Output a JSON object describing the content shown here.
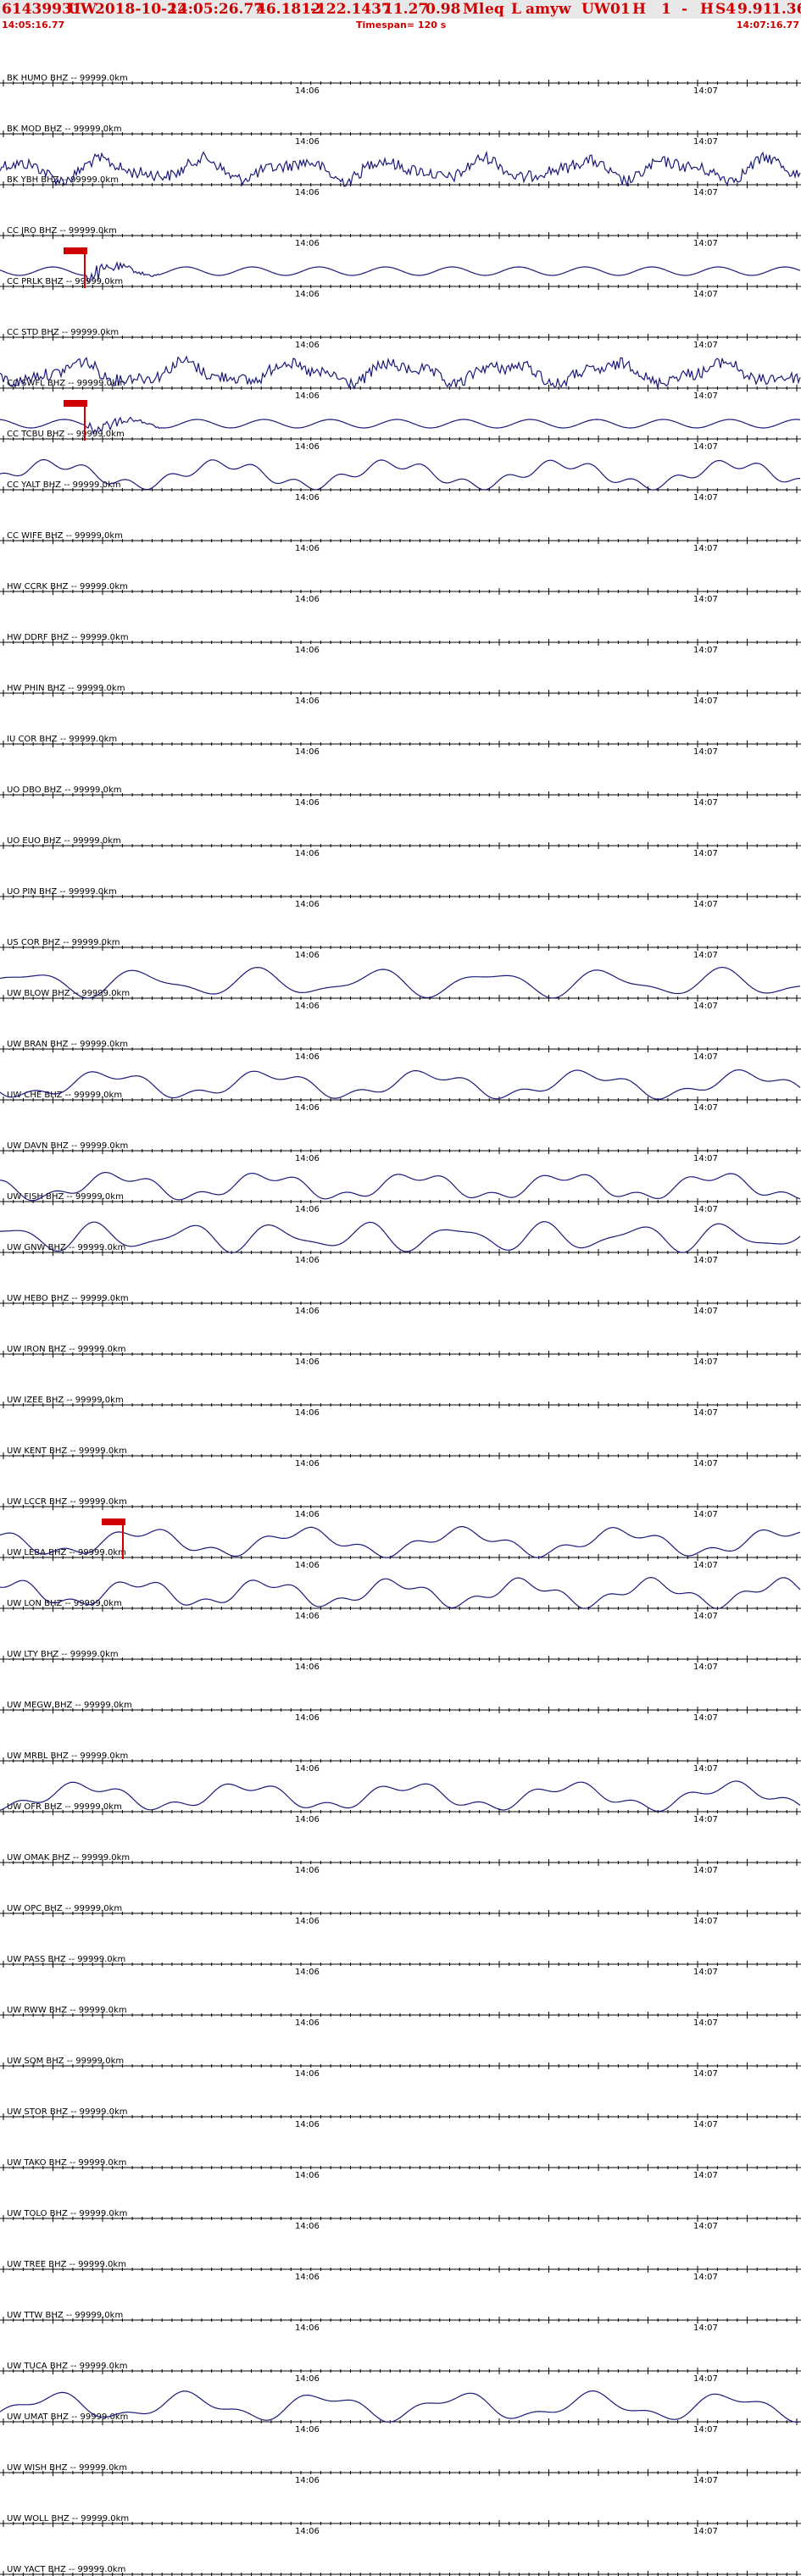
{
  "header": {
    "event_id": "61439931",
    "network": "UW",
    "origin_date": "2018-10-22",
    "origin_time": "14:05:26.77",
    "lat": "46.1812",
    "lon": "-122.1437",
    "depth": "11.27",
    "magnitude": "0.98",
    "mag_type": "Ml",
    "event_type": "eq",
    "flag": "L",
    "author": "amyw",
    "status_net": "UW",
    "status_code": "01",
    "status_h": "H",
    "status_n": "1",
    "status_dash": "-",
    "status_q": "H",
    "status_s": "S4",
    "val1": "9.91",
    "val2": "1.36",
    "start_time": "14:05:16.77",
    "timespan": "Timespan= 120 s",
    "end_time": "14:07:16.77"
  },
  "chart_data": {
    "type": "line",
    "time_ticks": [
      "14:06",
      "14:07"
    ],
    "channels": [
      {
        "label": "BK HUMO BHZ -- 99999.0km",
        "wave": "none"
      },
      {
        "label": "BK MOD BHZ -- 99999.0km",
        "wave": "none"
      },
      {
        "label": "BK YBH BHZ -- 99999.0km",
        "wave": "noisy"
      },
      {
        "label": "CC JRO BHZ -- 99999.0km",
        "wave": "none"
      },
      {
        "label": "CC PRLK BHZ -- 99999.0km",
        "wave": "event",
        "pick": true
      },
      {
        "label": "CC STD BHZ -- 99999.0km",
        "wave": "none"
      },
      {
        "label": "CC SWFL BHZ -- 99999.0km",
        "wave": "noisy"
      },
      {
        "label": "CC TCBU BHZ -- 99999.0km",
        "wave": "event",
        "pick": true
      },
      {
        "label": "CC YALT BHZ -- 99999.0km",
        "wave": "smooth"
      },
      {
        "label": "CC WIFE BHZ -- 99999.0km",
        "wave": "none"
      },
      {
        "label": "HW CCRK BHZ -- 99999.0km",
        "wave": "none"
      },
      {
        "label": "HW DDRF BHZ -- 99999.0km",
        "wave": "none"
      },
      {
        "label": "HW PHIN BHZ -- 99999.0km",
        "wave": "none"
      },
      {
        "label": "IU COR BHZ -- 99999.0km",
        "wave": "none"
      },
      {
        "label": "UO DBO BHZ -- 99999.0km",
        "wave": "none"
      },
      {
        "label": "UO EUO BHZ -- 99999.0km",
        "wave": "none"
      },
      {
        "label": "UO PIN BHZ -- 99999.0km",
        "wave": "none"
      },
      {
        "label": "US COR BHZ -- 99999.0km",
        "wave": "none"
      },
      {
        "label": "UW BLOW BHZ -- 99999.0km",
        "wave": "smooth"
      },
      {
        "label": "UW BRAN BHZ -- 99999.0km",
        "wave": "none"
      },
      {
        "label": "UW CHE BHZ -- 99999.0km",
        "wave": "smooth"
      },
      {
        "label": "UW DAVN BHZ -- 99999.0km",
        "wave": "none"
      },
      {
        "label": "UW FISH BHZ -- 99999.0km",
        "wave": "smooth"
      },
      {
        "label": "UW GNW BHZ -- 99999.0km",
        "wave": "smooth"
      },
      {
        "label": "UW HEBO BHZ -- 99999.0km",
        "wave": "none"
      },
      {
        "label": "UW IRON BHZ -- 99999.0km",
        "wave": "none"
      },
      {
        "label": "UW IZEE BHZ -- 99999.0km",
        "wave": "none"
      },
      {
        "label": "UW KENT BHZ -- 99999.0km",
        "wave": "none"
      },
      {
        "label": "UW LCCR BHZ -- 99999.0km",
        "wave": "none"
      },
      {
        "label": "UW LEBA BHZ -- 99999.0km",
        "wave": "smooth",
        "pick": true
      },
      {
        "label": "UW LON BHZ -- 99999.0km",
        "wave": "smooth"
      },
      {
        "label": "UW LTY BHZ -- 99999.0km",
        "wave": "none"
      },
      {
        "label": "UW MEGW BHZ -- 99999.0km",
        "wave": "none"
      },
      {
        "label": "UW MRBL BHZ -- 99999.0km",
        "wave": "none"
      },
      {
        "label": "UW OFR BHZ -- 99999.0km",
        "wave": "smooth"
      },
      {
        "label": "UW OMAK BHZ -- 99999.0km",
        "wave": "none"
      },
      {
        "label": "UW OPC BHZ -- 99999.0km",
        "wave": "none"
      },
      {
        "label": "UW PASS BHZ -- 99999.0km",
        "wave": "none"
      },
      {
        "label": "UW RWW BHZ -- 99999.0km",
        "wave": "none"
      },
      {
        "label": "UW SQM BHZ -- 99999.0km",
        "wave": "none"
      },
      {
        "label": "UW STOR BHZ -- 99999.0km",
        "wave": "none"
      },
      {
        "label": "UW TAKO BHZ -- 99999.0km",
        "wave": "none"
      },
      {
        "label": "UW TOLO BHZ -- 99999.0km",
        "wave": "none"
      },
      {
        "label": "UW TREE BHZ -- 99999.0km",
        "wave": "none"
      },
      {
        "label": "UW TTW BHZ -- 99999.0km",
        "wave": "none"
      },
      {
        "label": "UW TUCA BHZ -- 99999.0km",
        "wave": "none"
      },
      {
        "label": "UW UMAT BHZ -- 99999.0km",
        "wave": "smooth"
      },
      {
        "label": "UW WISH BHZ -- 99999.0km",
        "wave": "none"
      },
      {
        "label": "UW WOLL BHZ -- 99999.0km",
        "wave": "none"
      },
      {
        "label": "UW YACT BHZ -- 99999.0km",
        "wave": "none"
      }
    ]
  }
}
